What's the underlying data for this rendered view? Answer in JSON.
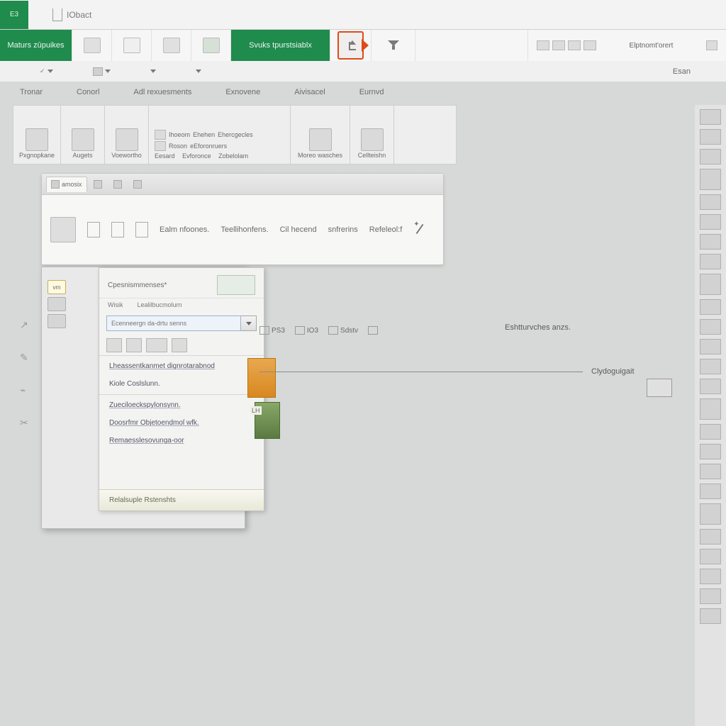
{
  "colors": {
    "brand_green": "#1f8b4c",
    "highlight_orange": "#e04a1a"
  },
  "titlebar": {
    "app_badge": "E3",
    "doc_name": "IObact"
  },
  "upper_tabs": {
    "main": "Maturs zūpuikes",
    "styles": "Svuks tpurstsiablx",
    "right_label": "Elptnomt'orert",
    "right_sublabel": "Esan"
  },
  "drop_row": {
    "right_label": "Esan"
  },
  "secondary_tabs": [
    "Tronar",
    "Conorl",
    "Adl rexuesments",
    "Exnovene",
    "Aivisacel",
    "Eurnvd"
  ],
  "ribbon": {
    "groups": [
      {
        "label": "Pxgnopk̇ane"
      },
      {
        "label": "Augets"
      },
      {
        "label": "Voewortho"
      },
      {
        "label_top_a": "Ihoeom",
        "label_top_b": "Ehehen",
        "label_top_c": "Ehercgecles",
        "label_mid_a": "Roson",
        "label_mid_b": "eEforonruers",
        "label_bottom_a": "Eesard",
        "label_bottom_b": "Evforonce",
        "label_bottom_c": "Zobelolam"
      },
      {
        "label": "Moreo wasches"
      },
      {
        "label": "Cellteishn"
      }
    ]
  },
  "subpanel": {
    "tab_active": "amosix",
    "body_text_a": "Ealm nfoones.",
    "body_text_b": "Teellihonfens.",
    "body_text_c": "Cil hecend",
    "body_text_d": "snfrerins",
    "body_text_e": "Refeleol:f"
  },
  "popup": {
    "left_badge": "vrn",
    "header": "Cpesnismmenses*",
    "row_labels": [
      "Wisik",
      "Lealilbucmolurn"
    ],
    "search_placeholder": "Ecenneergn da-drtu senns",
    "menu_items": [
      "Lheassentkanmet dignrotarabnod",
      "Kiole Coslslunn.",
      "Zueciloeckspylonsynn.",
      "Doosrfmr Objetoendmoſ wfk.",
      "Remaesslesovunga-oor"
    ],
    "footer_item": "Relalsuple Rstenshts",
    "small_label": "LH"
  },
  "canvas": {
    "tabbar": [
      "PS3",
      "IO3",
      "Sdstv"
    ],
    "title_right": "Eshtturvches anzs.",
    "drop_label": "Clydoguigait"
  }
}
